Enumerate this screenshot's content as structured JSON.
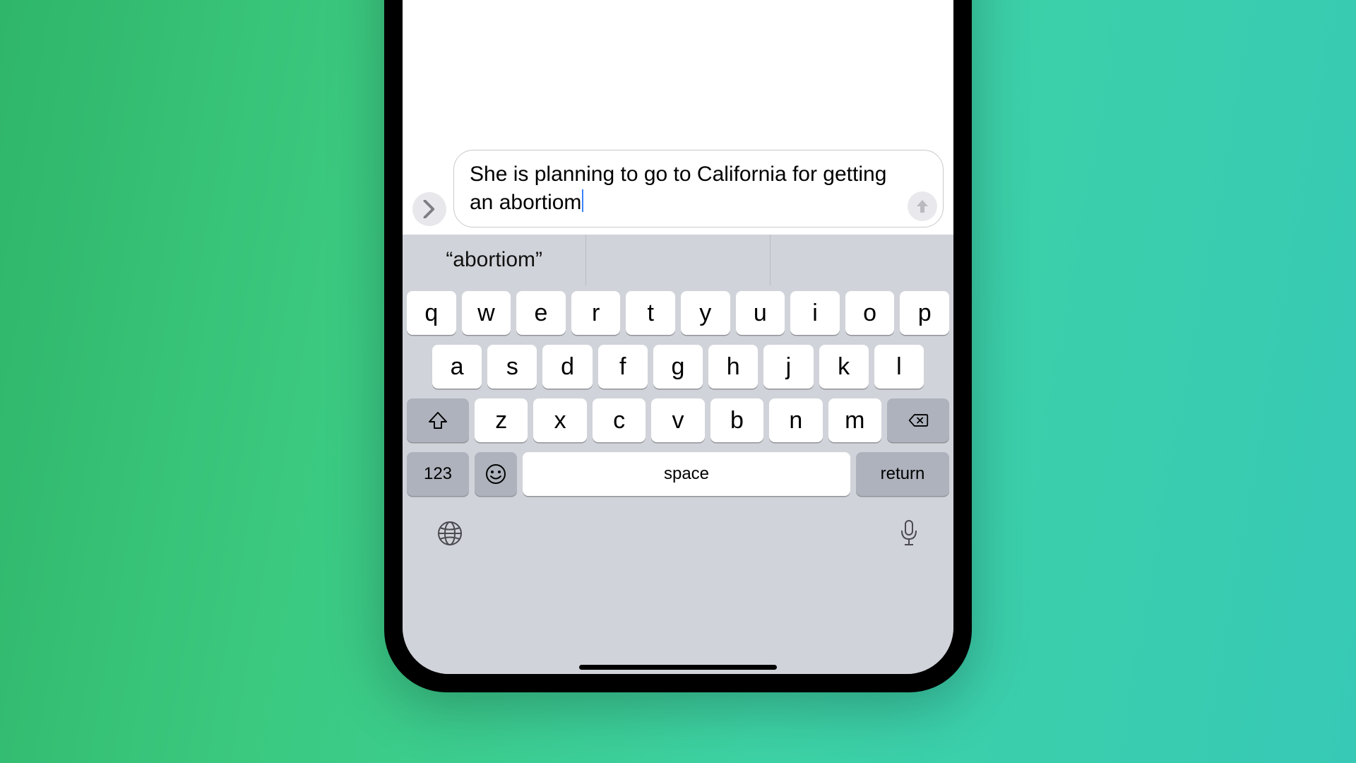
{
  "compose": {
    "text": "She is planning to go to California for getting an abortiom",
    "expand_label": "›"
  },
  "suggestions": [
    "“abortiom”",
    "",
    ""
  ],
  "keyboard": {
    "row1": [
      "q",
      "w",
      "e",
      "r",
      "t",
      "y",
      "u",
      "i",
      "o",
      "p"
    ],
    "row2": [
      "a",
      "s",
      "d",
      "f",
      "g",
      "h",
      "j",
      "k",
      "l"
    ],
    "row3": [
      "z",
      "x",
      "c",
      "v",
      "b",
      "n",
      "m"
    ],
    "numbers_label": "123",
    "space_label": "space",
    "return_label": "return"
  }
}
